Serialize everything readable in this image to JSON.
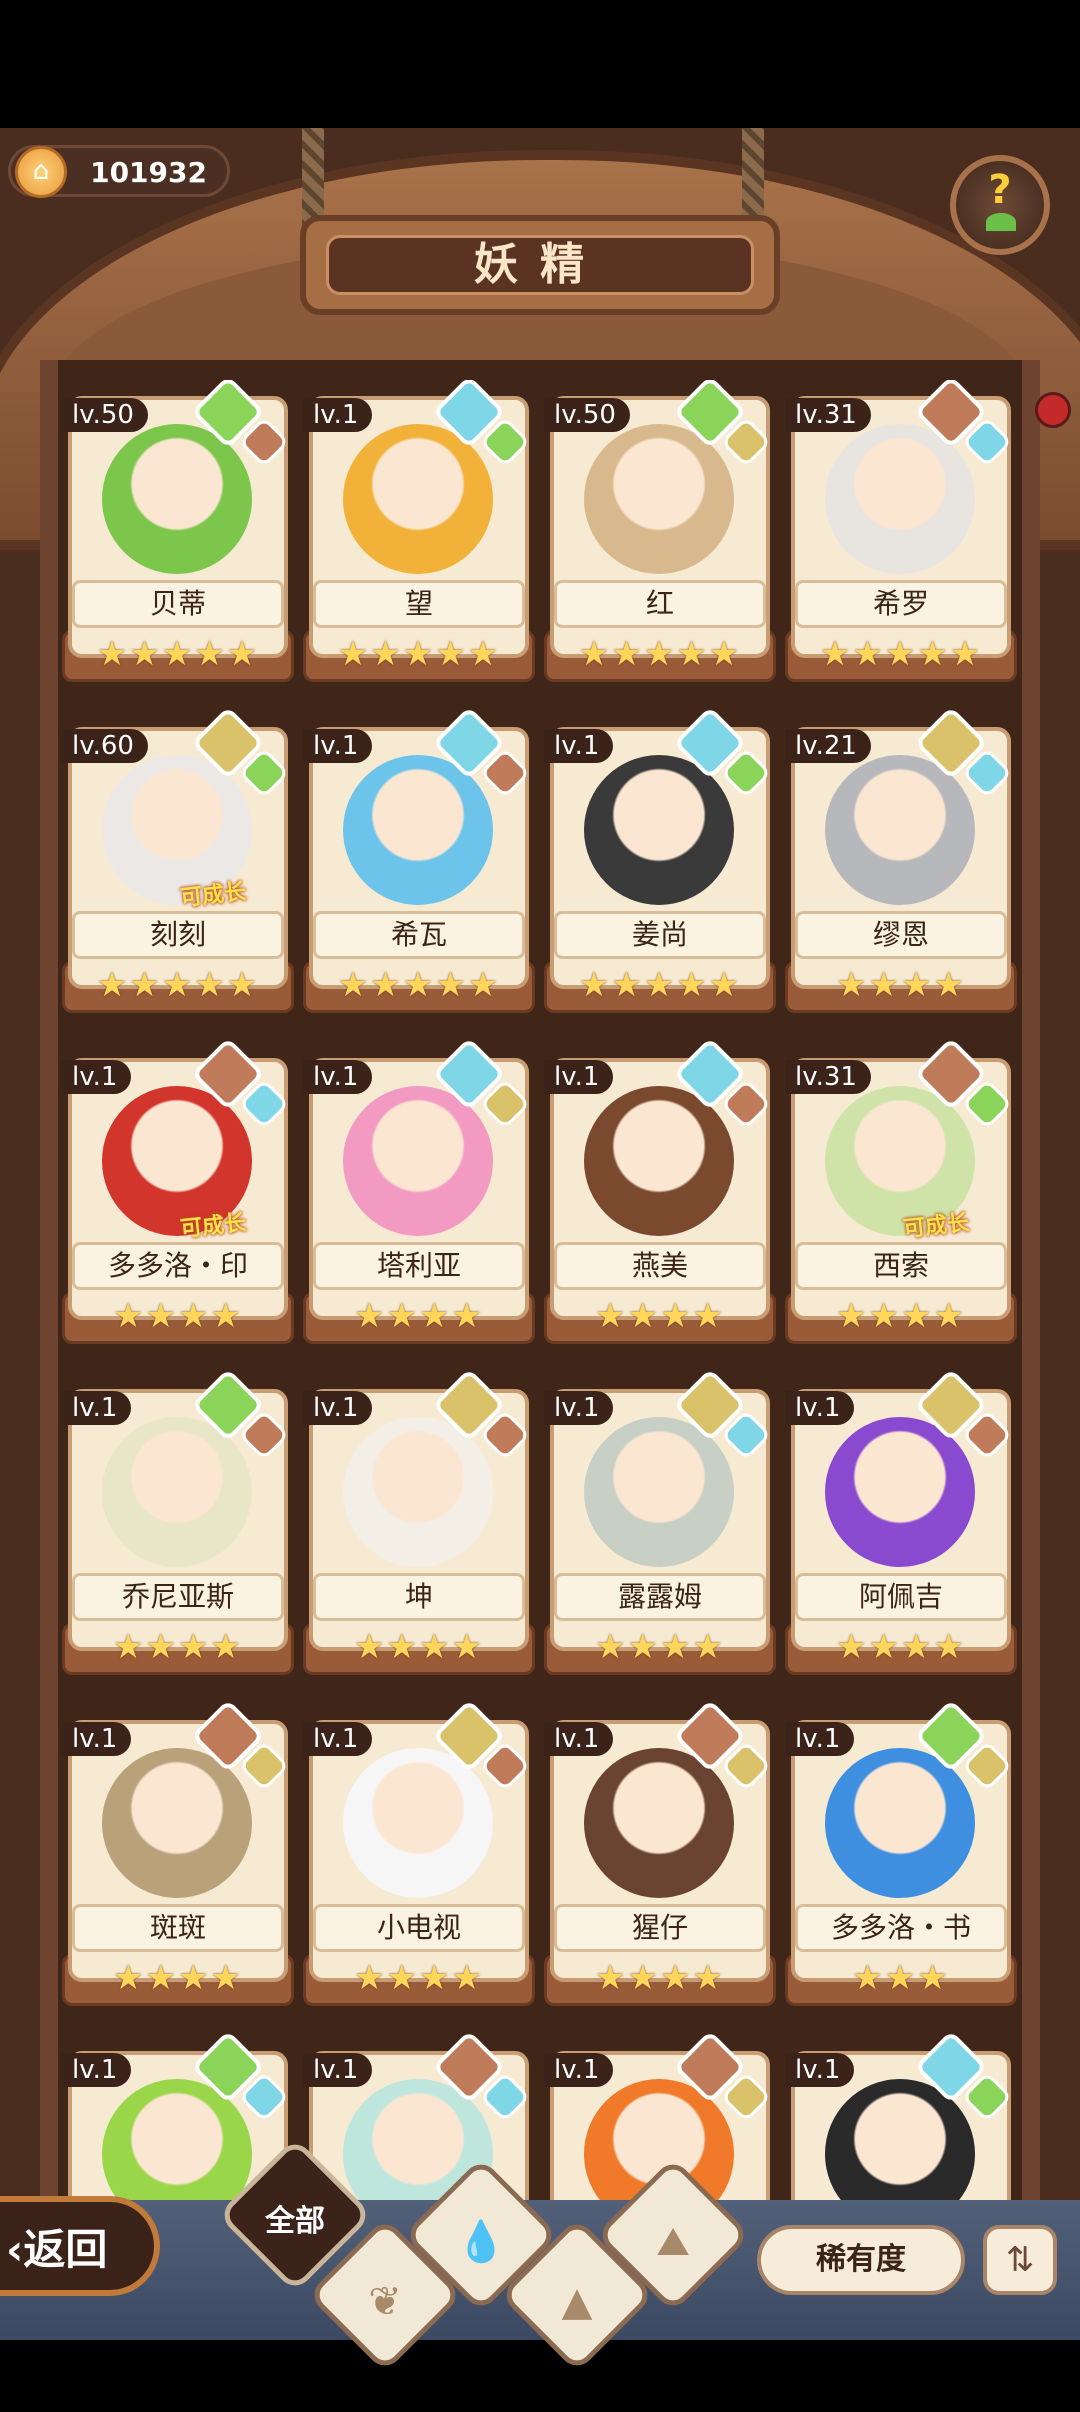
{
  "currency": {
    "value": "101932",
    "icon": "coin-house-icon"
  },
  "header": {
    "title": "妖精"
  },
  "help": {
    "glyph": "?"
  },
  "cards": [
    {
      "level": "lv.50",
      "name": "贝蒂",
      "stars": "★★★★★",
      "grow": "",
      "elem": [
        "plant",
        "fire"
      ],
      "color": "#7cc64b"
    },
    {
      "level": "lv.1",
      "name": "望",
      "stars": "★★★★★",
      "grow": "",
      "elem": [
        "water",
        "plant"
      ],
      "color": "#f2b23a"
    },
    {
      "level": "lv.50",
      "name": "红",
      "stars": "★★★★★",
      "grow": "",
      "elem": [
        "plant",
        "earth"
      ],
      "color": "#d8b98e"
    },
    {
      "level": "lv.31",
      "name": "希罗",
      "stars": "★★★★★",
      "grow": "",
      "elem": [
        "fire",
        "water"
      ],
      "color": "#e8e4e0"
    },
    {
      "level": "lv.60",
      "name": "刻刻",
      "stars": "★★★★★",
      "grow": "可成长",
      "elem": [
        "earth",
        "plant"
      ],
      "color": "#ece8e6"
    },
    {
      "level": "lv.1",
      "name": "希瓦",
      "stars": "★★★★★",
      "grow": "",
      "elem": [
        "water",
        "fire"
      ],
      "color": "#6cc4ea"
    },
    {
      "level": "lv.1",
      "name": "姜尚",
      "stars": "★★★★★",
      "grow": "",
      "elem": [
        "water",
        "plant"
      ],
      "color": "#3a3a3a"
    },
    {
      "level": "lv.21",
      "name": "缪恩",
      "stars": "★★★★",
      "grow": "",
      "elem": [
        "earth",
        "water"
      ],
      "color": "#b6b8bc"
    },
    {
      "level": "lv.1",
      "name": "多多洛・印",
      "stars": "★★★★",
      "grow": "可成长",
      "elem": [
        "fire",
        "water"
      ],
      "color": "#d2352c"
    },
    {
      "level": "lv.1",
      "name": "塔利亚",
      "stars": "★★★★",
      "grow": "",
      "elem": [
        "water",
        "earth"
      ],
      "color": "#f29ac2"
    },
    {
      "level": "lv.1",
      "name": "燕美",
      "stars": "★★★★",
      "grow": "",
      "elem": [
        "water",
        "fire"
      ],
      "color": "#7b4a2e"
    },
    {
      "level": "lv.31",
      "name": "西索",
      "stars": "★★★★",
      "grow": "可成长",
      "elem": [
        "fire",
        "plant"
      ],
      "color": "#cfe3a8"
    },
    {
      "level": "lv.1",
      "name": "乔尼亚斯",
      "stars": "★★★★",
      "grow": "",
      "elem": [
        "plant",
        "fire"
      ],
      "color": "#e9e6c8"
    },
    {
      "level": "lv.1",
      "name": "坤",
      "stars": "★★★★",
      "grow": "",
      "elem": [
        "earth",
        "fire"
      ],
      "color": "#f3efe6"
    },
    {
      "level": "lv.1",
      "name": "露露姆",
      "stars": "★★★★",
      "grow": "",
      "elem": [
        "earth",
        "water"
      ],
      "color": "#c8cfc4"
    },
    {
      "level": "lv.1",
      "name": "阿佩吉",
      "stars": "★★★★",
      "grow": "",
      "elem": [
        "earth",
        "fire"
      ],
      "color": "#8a4ad0"
    },
    {
      "level": "lv.1",
      "name": "斑斑",
      "stars": "★★★★",
      "grow": "",
      "elem": [
        "fire",
        "earth"
      ],
      "color": "#b9a27a"
    },
    {
      "level": "lv.1",
      "name": "小电视",
      "stars": "★★★★",
      "grow": "",
      "elem": [
        "earth",
        "fire"
      ],
      "color": "#f6f6f6"
    },
    {
      "level": "lv.1",
      "name": "猩仔",
      "stars": "★★★★",
      "grow": "",
      "elem": [
        "fire",
        "earth"
      ],
      "color": "#6a4332"
    },
    {
      "level": "lv.1",
      "name": "多多洛・书",
      "stars": "★★★",
      "grow": "",
      "elem": [
        "plant",
        "earth"
      ],
      "color": "#3e8fe0"
    },
    {
      "level": "lv.1",
      "name": "",
      "stars": "",
      "grow": "",
      "elem": [
        "plant",
        "water"
      ],
      "color": "#9ad64a"
    },
    {
      "level": "lv.1",
      "name": "",
      "stars": "",
      "grow": "",
      "elem": [
        "fire",
        "water"
      ],
      "color": "#bfe6dc"
    },
    {
      "level": "lv.1",
      "name": "",
      "stars": "",
      "grow": "",
      "elem": [
        "fire",
        "earth"
      ],
      "color": "#f07a2a"
    },
    {
      "level": "lv.1",
      "name": "",
      "stars": "",
      "grow": "",
      "elem": [
        "water",
        "plant"
      ],
      "color": "#2a2a2a"
    }
  ],
  "bottom": {
    "back_label": "返回",
    "filter_all_label": "全部",
    "rarity_label": "稀有度",
    "filters": [
      "plant-filter-icon",
      "water-filter-icon",
      "earth-filter-icon",
      "fire-filter-icon"
    ]
  }
}
